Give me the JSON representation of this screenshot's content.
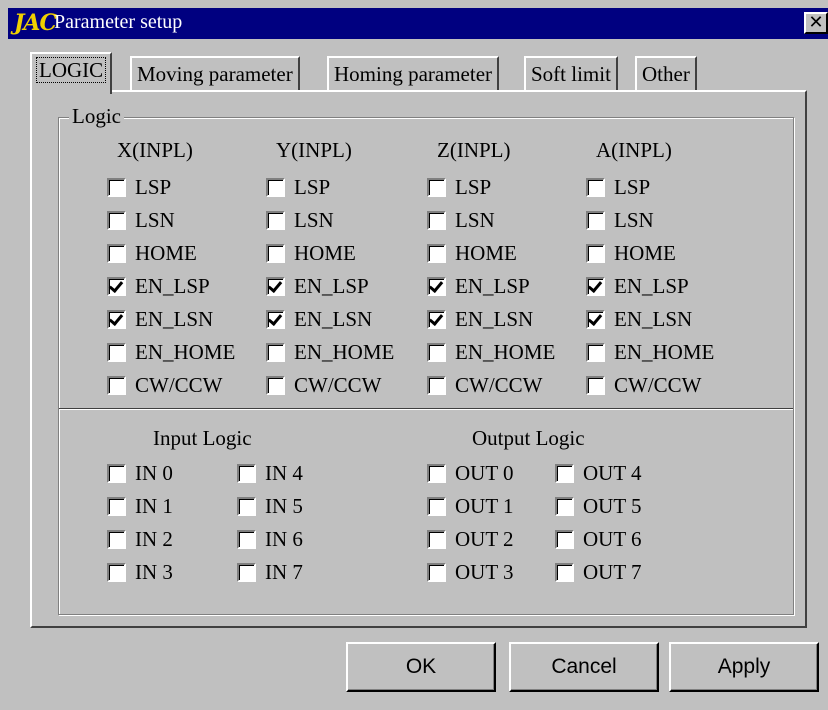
{
  "window": {
    "logo": "JAC",
    "title": "Parameter setup",
    "close_glyph": "✕"
  },
  "tabs": [
    {
      "label": "LOGIC",
      "active": true
    },
    {
      "label": "Moving parameter",
      "active": false
    },
    {
      "label": "Homing parameter",
      "active": false
    },
    {
      "label": "Soft limit",
      "active": false
    },
    {
      "label": "Other",
      "active": false
    }
  ],
  "logic_group": {
    "label": "Logic",
    "axes": [
      {
        "name": "X(INPL)",
        "options": [
          {
            "label": "LSP",
            "checked": false
          },
          {
            "label": "LSN",
            "checked": false
          },
          {
            "label": "HOME",
            "checked": false
          },
          {
            "label": "EN_LSP",
            "checked": true
          },
          {
            "label": "EN_LSN",
            "checked": true
          },
          {
            "label": "EN_HOME",
            "checked": false
          },
          {
            "label": "CW/CCW",
            "checked": false
          }
        ]
      },
      {
        "name": "Y(INPL)",
        "options": [
          {
            "label": "LSP",
            "checked": false
          },
          {
            "label": "LSN",
            "checked": false
          },
          {
            "label": "HOME",
            "checked": false
          },
          {
            "label": "EN_LSP",
            "checked": true
          },
          {
            "label": "EN_LSN",
            "checked": true
          },
          {
            "label": "EN_HOME",
            "checked": false
          },
          {
            "label": "CW/CCW",
            "checked": false
          }
        ]
      },
      {
        "name": "Z(INPL)",
        "options": [
          {
            "label": "LSP",
            "checked": false
          },
          {
            "label": "LSN",
            "checked": false
          },
          {
            "label": "HOME",
            "checked": false
          },
          {
            "label": "EN_LSP",
            "checked": true
          },
          {
            "label": "EN_LSN",
            "checked": true
          },
          {
            "label": "EN_HOME",
            "checked": false
          },
          {
            "label": "CW/CCW",
            "checked": false
          }
        ]
      },
      {
        "name": "A(INPL)",
        "options": [
          {
            "label": "LSP",
            "checked": false
          },
          {
            "label": "LSN",
            "checked": false
          },
          {
            "label": "HOME",
            "checked": false
          },
          {
            "label": "EN_LSP",
            "checked": true
          },
          {
            "label": "EN_LSN",
            "checked": true
          },
          {
            "label": "EN_HOME",
            "checked": false
          },
          {
            "label": "CW/CCW",
            "checked": false
          }
        ]
      }
    ],
    "input_logic": {
      "label": "Input Logic",
      "items": [
        {
          "label": "IN 0",
          "checked": false
        },
        {
          "label": "IN 1",
          "checked": false
        },
        {
          "label": "IN 2",
          "checked": false
        },
        {
          "label": "IN 3",
          "checked": false
        },
        {
          "label": "IN 4",
          "checked": false
        },
        {
          "label": "IN 5",
          "checked": false
        },
        {
          "label": "IN 6",
          "checked": false
        },
        {
          "label": "IN 7",
          "checked": false
        }
      ]
    },
    "output_logic": {
      "label": "Output Logic",
      "items": [
        {
          "label": "OUT 0",
          "checked": false
        },
        {
          "label": "OUT 1",
          "checked": false
        },
        {
          "label": "OUT 2",
          "checked": false
        },
        {
          "label": "OUT 3",
          "checked": false
        },
        {
          "label": "OUT 4",
          "checked": false
        },
        {
          "label": "OUT 5",
          "checked": false
        },
        {
          "label": "OUT 6",
          "checked": false
        },
        {
          "label": "OUT 7",
          "checked": false
        }
      ]
    }
  },
  "buttons": {
    "ok": "OK",
    "cancel": "Cancel",
    "apply": "Apply"
  }
}
